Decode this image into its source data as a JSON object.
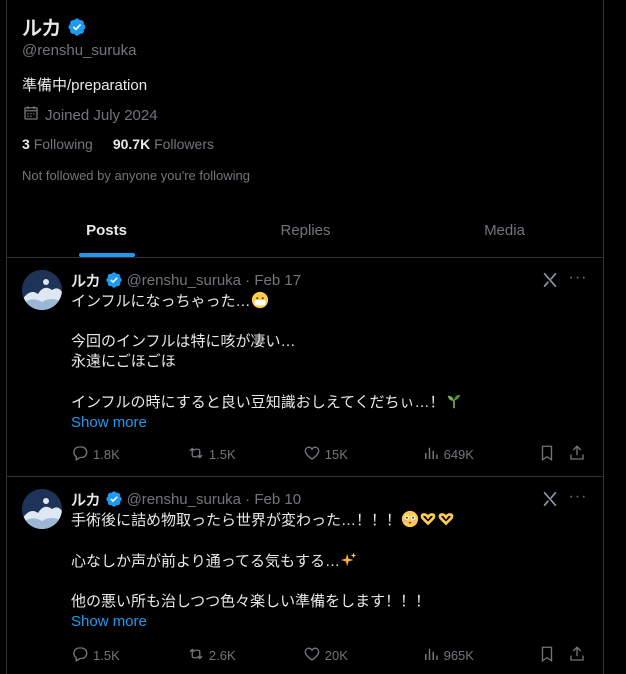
{
  "profile": {
    "display_name": "ルカ",
    "handle": "@renshu_suruka",
    "bio": "準備中/preparation",
    "joined": "Joined July 2024",
    "following_count": "3",
    "following_label": "Following",
    "followers_count": "90.7K",
    "followers_label": "Followers",
    "not_followed": "Not followed by anyone you're following"
  },
  "tabs": [
    {
      "label": "Posts",
      "active": true
    },
    {
      "label": "Replies",
      "active": false
    },
    {
      "label": "Media",
      "active": false
    }
  ],
  "posts": [
    {
      "name": "ルカ",
      "meta": "@renshu_suruka · Feb 17",
      "lines": [
        "インフルになっちゃった…",
        "",
        "今回のインフルは特に咳が凄い…",
        "永遠にごほごほ",
        "",
        "インフルの時にすると良い豆知識おしえてくだちぃ…！"
      ],
      "line_emojis": [
        "mask-face",
        "",
        "",
        "",
        "",
        "seedling"
      ],
      "show_more": "Show more",
      "replies": "1.8K",
      "reposts": "1.5K",
      "likes": "15K",
      "views": "649K"
    },
    {
      "name": "ルカ",
      "meta": "@renshu_suruka · Feb 10",
      "lines": [
        "手術後に詰め物取ったら世界が変わった…！！！",
        "",
        "心なしか声が前より通ってる気もする…",
        "",
        "他の悪い所も治しつつ色々楽しい準備をします！！！"
      ],
      "line_emojis": [
        "flushed-face heart-hands heart-hands",
        "",
        "sparkles",
        "",
        ""
      ],
      "show_more": "Show more",
      "replies": "1.5K",
      "reposts": "2.6K",
      "likes": "20K",
      "views": "965K"
    }
  ],
  "colors": {
    "accent": "#1d9bf0",
    "text": "#e7e9ea",
    "muted": "#71767b",
    "border": "#2f3336"
  }
}
